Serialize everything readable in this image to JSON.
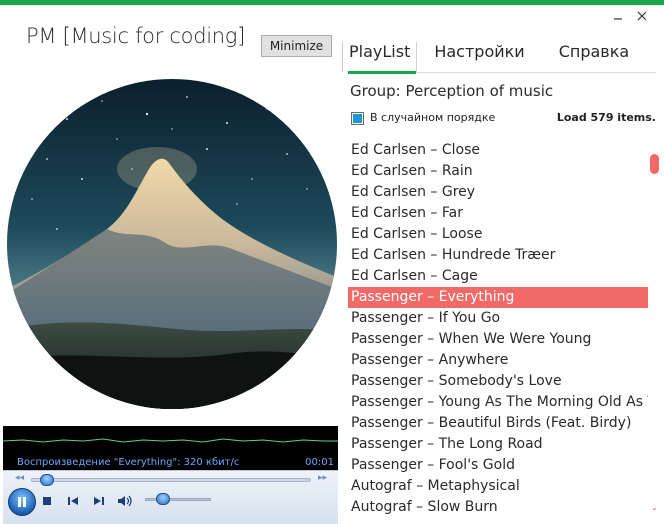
{
  "app": {
    "title": "PM [Music for coding]",
    "minimize_label": "Minimize",
    "accent_color": "#1aa64b"
  },
  "player": {
    "status": "Воспроизведение \"Everything\": 320 кбит/с",
    "time": "00:01",
    "seek_fraction": 0.03,
    "volume_fraction": 0.2
  },
  "tabs": [
    {
      "label": "PlayList",
      "active": true
    },
    {
      "label": "Настройки",
      "active": false
    },
    {
      "label": "Справка",
      "active": false
    }
  ],
  "group": {
    "label": "Group: Perception of music"
  },
  "shuffle": {
    "label": "В случайном порядке",
    "checked": true
  },
  "load_status": "Load 579 items.",
  "playlist": {
    "selected_color": "#f26a68",
    "tracks": [
      {
        "title": "Ed Carlsen – Close",
        "selected": false
      },
      {
        "title": "Ed Carlsen – Rain",
        "selected": false
      },
      {
        "title": "Ed Carlsen – Grey",
        "selected": false
      },
      {
        "title": "Ed Carlsen – Far",
        "selected": false
      },
      {
        "title": "Ed Carlsen – Loose",
        "selected": false
      },
      {
        "title": "Ed Carlsen – Hundrede Træer",
        "selected": false
      },
      {
        "title": "Ed Carlsen – Cage",
        "selected": false
      },
      {
        "title": "Passenger – Everything",
        "selected": true
      },
      {
        "title": "Passenger – If You Go",
        "selected": false
      },
      {
        "title": "Passenger – When We Were Young",
        "selected": false
      },
      {
        "title": "Passenger – Anywhere",
        "selected": false
      },
      {
        "title": "Passenger – Somebody's Love",
        "selected": false
      },
      {
        "title": "Passenger – Young As The Morning Old As T",
        "selected": false
      },
      {
        "title": "Passenger – Beautiful Birds (Feat. Birdy)",
        "selected": false
      },
      {
        "title": "Passenger – The Long Road",
        "selected": false
      },
      {
        "title": "Passenger – Fool's Gold",
        "selected": false
      },
      {
        "title": "Autograf  – Metaphysical",
        "selected": false
      },
      {
        "title": "Autograf – Slow Burn",
        "selected": false
      }
    ]
  }
}
